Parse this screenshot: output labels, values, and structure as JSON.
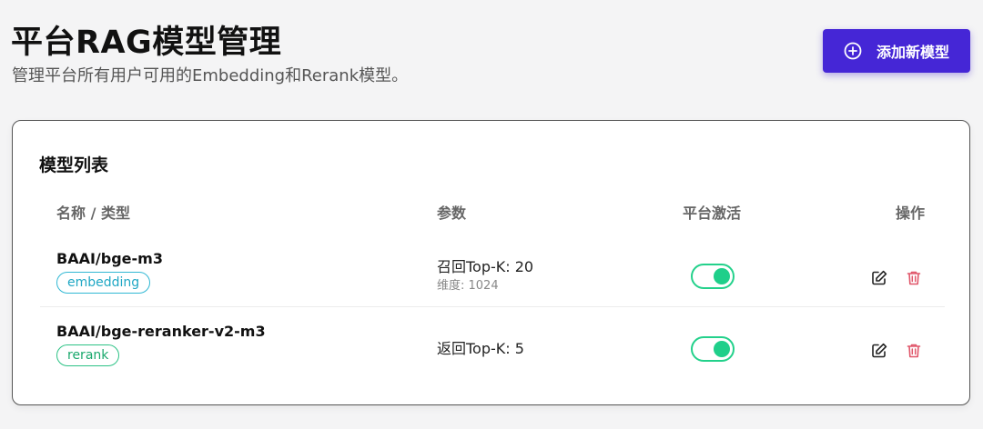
{
  "header": {
    "title": "平台RAG模型管理",
    "subtitle": "管理平台所有用户可用的Embedding和Rerank模型。",
    "add_button_label": "添加新模型"
  },
  "card": {
    "title": "模型列表",
    "columns": {
      "name": "名称 / 类型",
      "params": "参数",
      "active": "平台激活",
      "actions": "操作"
    },
    "rows": [
      {
        "name": "BAAI/bge-m3",
        "type": "embedding",
        "param_main": "召回Top-K: 20",
        "param_sub": "维度: 1024",
        "active": true
      },
      {
        "name": "BAAI/bge-reranker-v2-m3",
        "type": "rerank",
        "param_main": "返回Top-K: 5",
        "active": true
      }
    ]
  },
  "colors": {
    "primary": "#4526d6",
    "toggle_on": "#1fcf8a",
    "embedding_tag": "#1fa7c4",
    "rerank_tag": "#19a86c",
    "delete_icon": "#e0566a"
  },
  "icons": {
    "add": "plus-circle-icon",
    "edit": "edit-icon",
    "delete": "trash-icon"
  }
}
